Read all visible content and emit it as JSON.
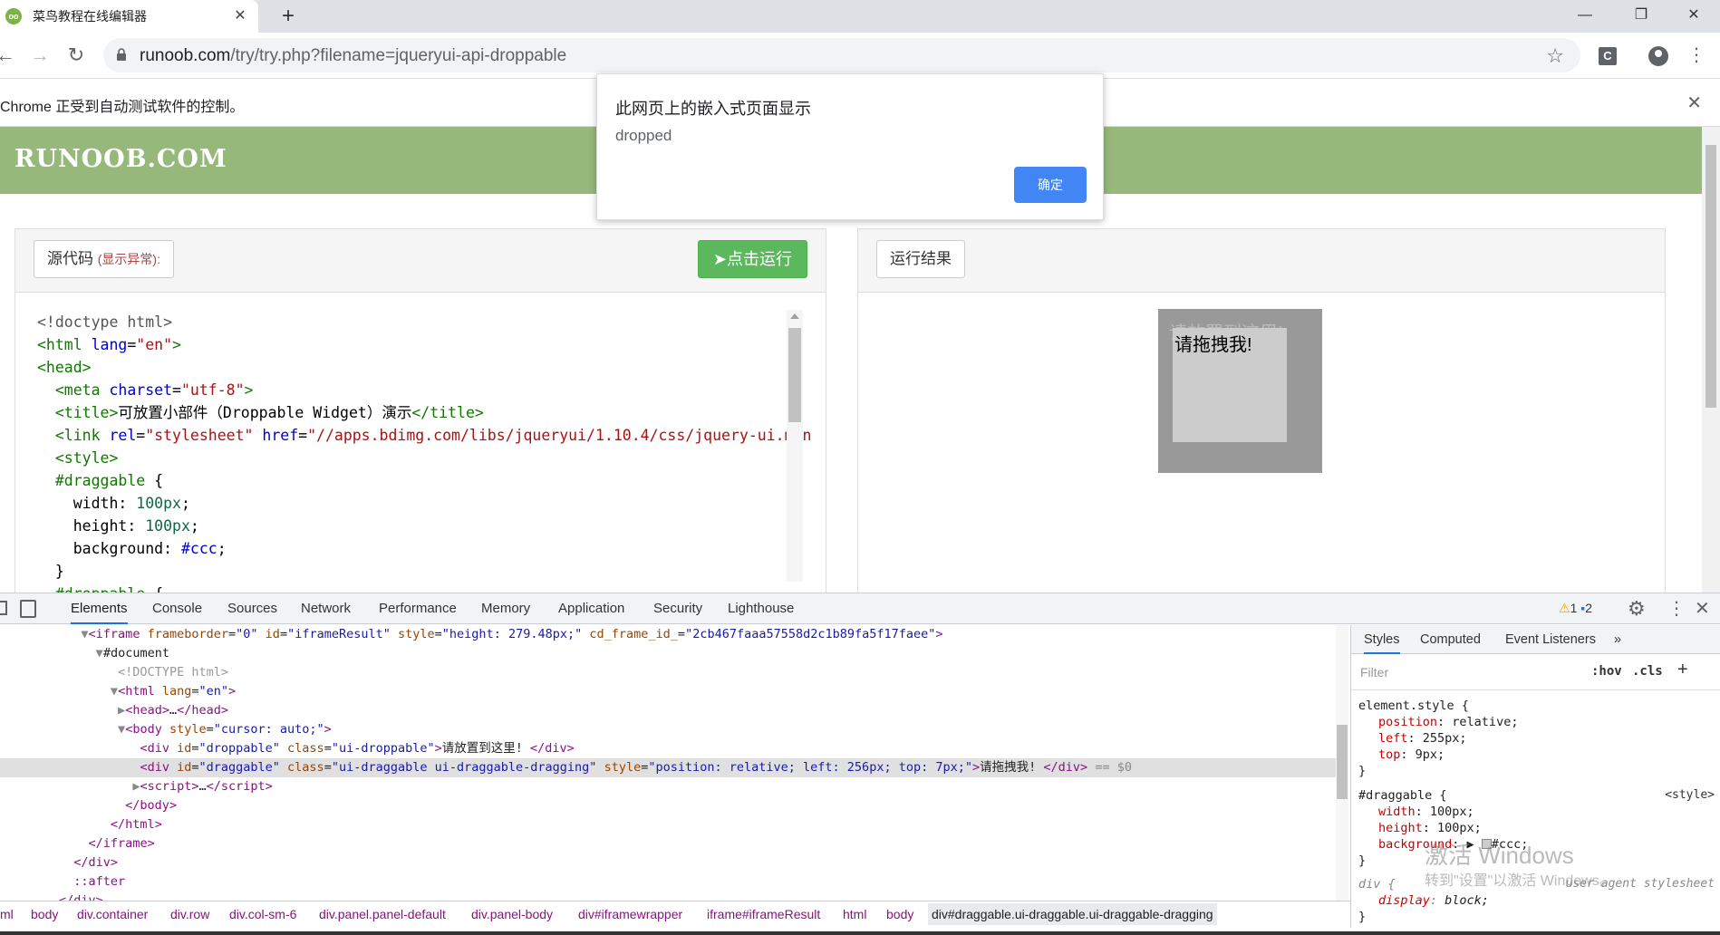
{
  "browser": {
    "tab_title": "菜鸟教程在线编辑器",
    "tab_favicon": "runoob-favicon",
    "tab_close": "✕",
    "new_tab": "+",
    "url_host": "runoob.com",
    "url_path": "/try/try.php?filename=jqueryui-api-droppable",
    "window_minimize": "—",
    "window_restore": "❐",
    "window_close": "✕",
    "extension_label": "C"
  },
  "infobar": {
    "text": "Chrome 正受到自动测试软件的控制。",
    "close": "✕"
  },
  "site": {
    "logo": "RUNOOB.COM"
  },
  "source_panel": {
    "heading": "源代码 ",
    "heading_paren_open": "(",
    "heading_warning": "显示异常",
    "heading_paren_close": "):",
    "run_button": "点击运行"
  },
  "result_panel": {
    "heading": "运行结果",
    "droppable_text": "请放置到这里!",
    "draggable_text": "请拖拽我!"
  },
  "alert": {
    "title": "此网页上的嵌入式页面显示",
    "message": "dropped",
    "ok_label": "确定"
  },
  "devtools": {
    "tabs": [
      "Elements",
      "Console",
      "Sources",
      "Network",
      "Performance",
      "Memory",
      "Application",
      "Security",
      "Lighthouse"
    ],
    "active_tab": "Elements",
    "warning_count": "1",
    "info_count": "2",
    "breadcrumbs": [
      "ml",
      "body",
      "div.container",
      "div.row",
      "div.col-sm-6",
      "div.panel.panel-default",
      "div.panel-body",
      "div#iframewrapper",
      "iframe#iframeResult",
      "html",
      "body",
      "div#draggable.ui-draggable.ui-draggable-dragging"
    ],
    "styles_tabs": [
      "Styles",
      "Computed",
      "Event Listeners"
    ],
    "filter_placeholder": "Filter",
    "hov": ":hov",
    "cls": ".cls",
    "element_style_selector": "element.style {",
    "element_style": [
      {
        "prop": "position",
        "value": "relative;"
      },
      {
        "prop": "left",
        "value": "255px;"
      },
      {
        "prop": "top",
        "value": "9px;"
      }
    ],
    "draggable_selector": "#draggable {",
    "draggable_source": "<style>",
    "draggable_rules": [
      {
        "prop": "width",
        "value": "100px;"
      },
      {
        "prop": "height",
        "value": "100px;"
      },
      {
        "prop": "background",
        "value": "#ccc;"
      }
    ],
    "div_selector": "div {",
    "div_source": "user agent stylesheet",
    "div_rule": {
      "prop": "display",
      "value": "block;"
    },
    "close_brace": "}"
  },
  "windows_watermark": {
    "line1": "激活 Windows",
    "line2": "转到\"设置\"以激活 Windows。"
  }
}
